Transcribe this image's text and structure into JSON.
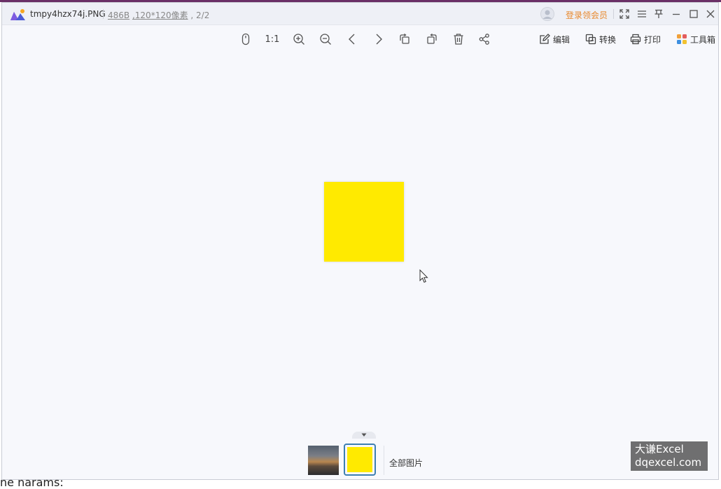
{
  "title_bar": {
    "file_name": "tmpy4hzx74j.PNG",
    "file_size": "486B",
    "dimensions": ",120*120像素",
    "page_index": ", 2/2",
    "login_label": "登录领会员"
  },
  "toolbar": {
    "one_to_one_label": "1:1"
  },
  "right_tools": {
    "edit_label": "编辑",
    "convert_label": "转换",
    "print_label": "打印",
    "toolbox_label": "工具箱"
  },
  "thumbnails": {
    "all_images_label": "全部图片"
  },
  "watermark": {
    "line1": "大谦Excel",
    "line2": "dqexcel.com"
  },
  "background_text": "ne    narams:",
  "colors": {
    "accent": "#3d7fb1",
    "login": "#e8892e",
    "image_fill": "#ffea00"
  }
}
